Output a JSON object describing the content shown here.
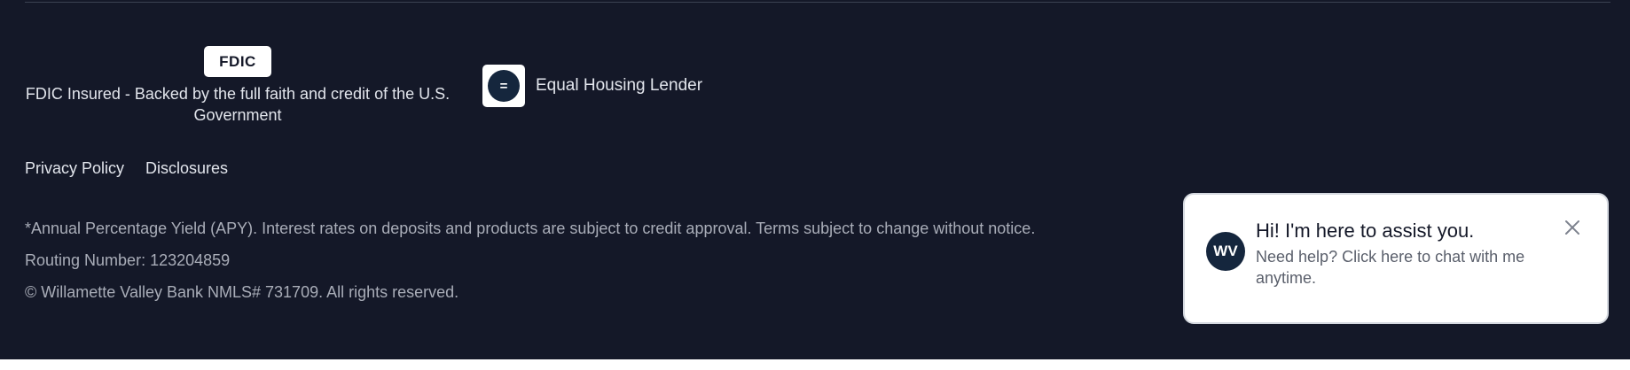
{
  "fdic": {
    "badge": "FDIC",
    "text": "FDIC Insured - Backed by the full faith and credit of the U.S. Government"
  },
  "equal_housing": {
    "icon_symbol": "=",
    "label": "Equal Housing Lender"
  },
  "links": {
    "privacy": "Privacy Policy",
    "disclosures": "Disclosures"
  },
  "legal": {
    "apy": "*Annual Percentage Yield (APY). Interest rates on deposits and products are subject to credit approval. Terms subject to change without notice.",
    "routing": "Routing Number: 123204859",
    "copyright": "© Willamette Valley Bank NMLS# 731709. All rights reserved."
  },
  "chat": {
    "avatar_initials": "WV",
    "title": "Hi! I'm here to assist you.",
    "subtitle": "Need help? Click here to chat with me anytime.",
    "close_icon": "close-icon"
  },
  "colors": {
    "footer_bg": "#141828",
    "text_light": "#e2e5ec",
    "text_muted": "#a9adb8",
    "brand_navy": "#15263d"
  }
}
